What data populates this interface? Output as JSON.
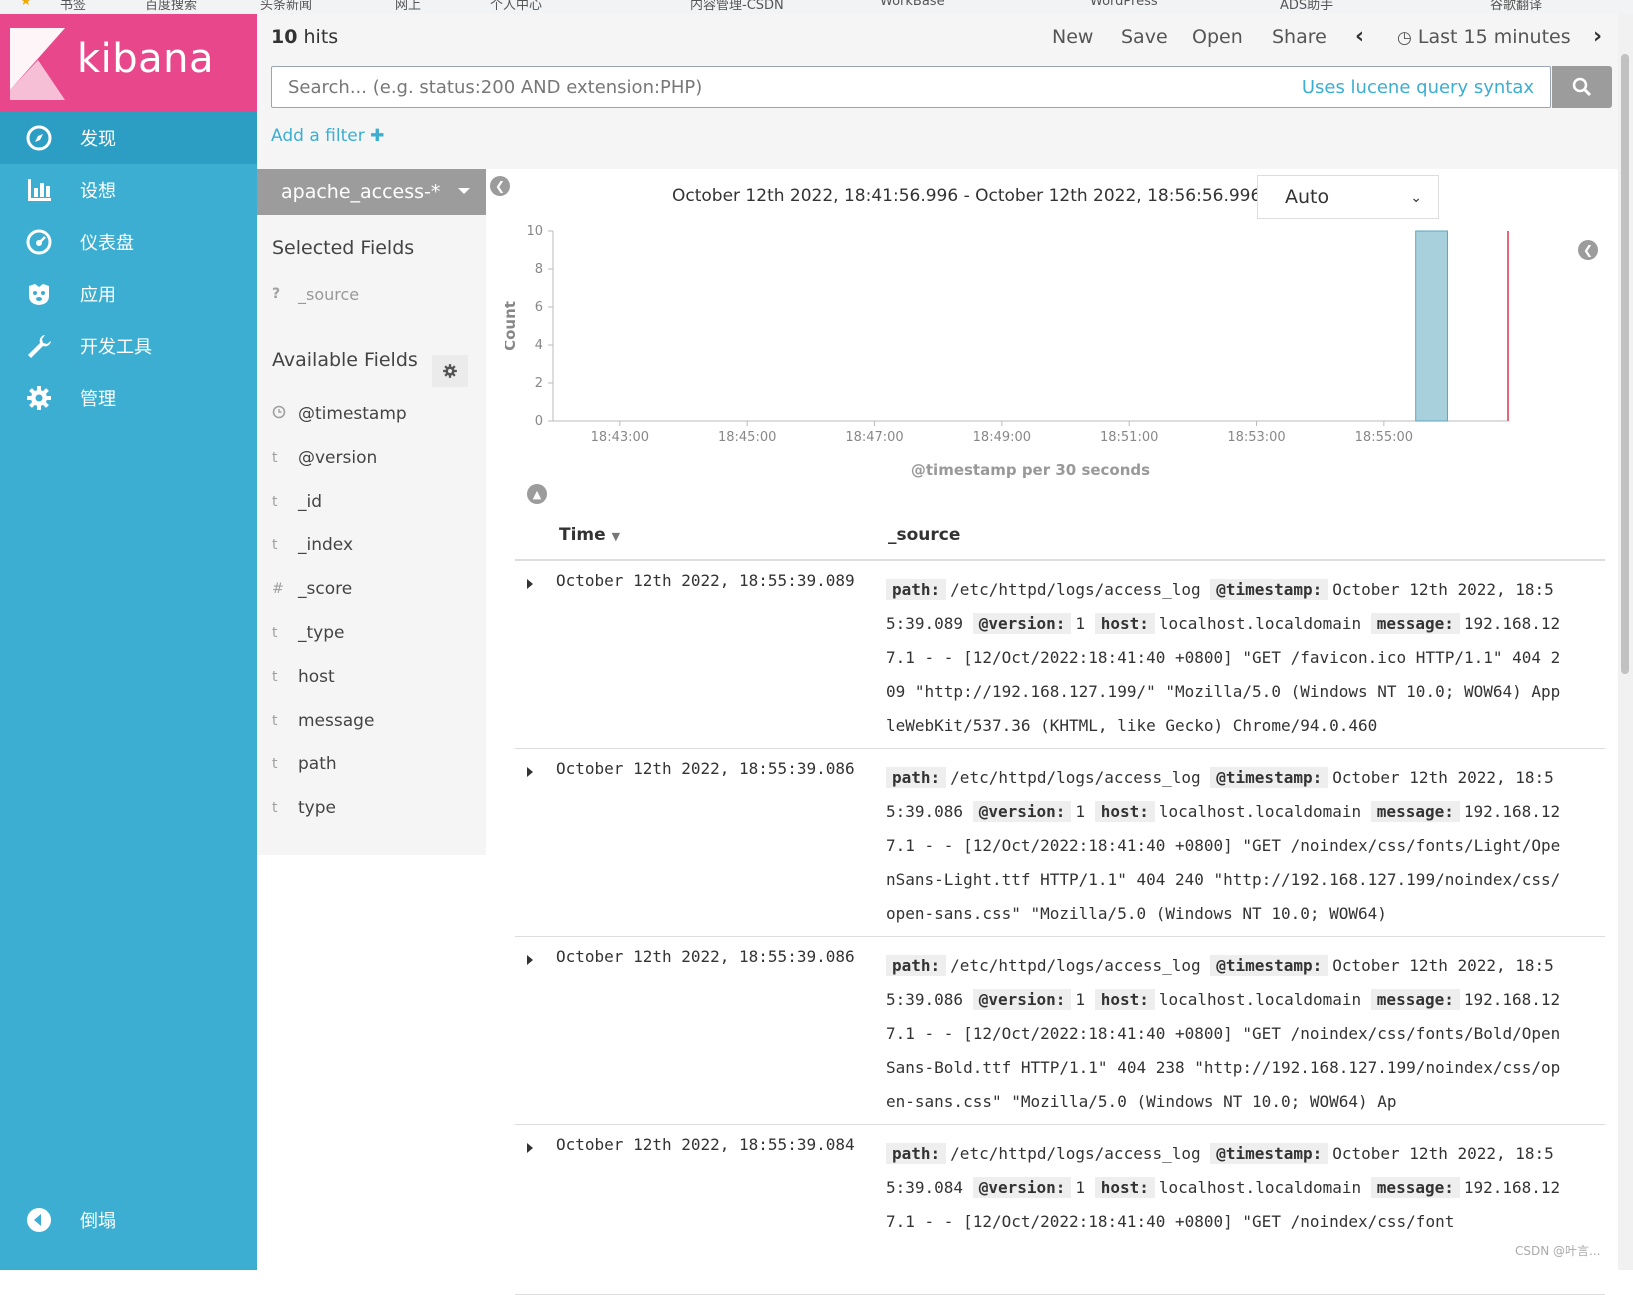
{
  "browser": {
    "bookmarks": [
      "书签",
      "百度搜索",
      "头条新闻",
      "网上",
      "个人中心",
      "内容管理-CSDN",
      "WorkBase",
      "WordPress",
      "ADS助手",
      "谷歌翻译"
    ]
  },
  "app": {
    "logo_text": "kibana"
  },
  "nav": [
    {
      "label": "发现",
      "icon": "compass-icon",
      "active": true
    },
    {
      "label": "设想",
      "icon": "bar-chart-icon",
      "active": false
    },
    {
      "label": "仪表盘",
      "icon": "dashboard-icon",
      "active": false
    },
    {
      "label": "应用",
      "icon": "bear-icon",
      "active": false
    },
    {
      "label": "开发工具",
      "icon": "wrench-icon",
      "active": false
    },
    {
      "label": "管理",
      "icon": "gear-icon",
      "active": false
    },
    {
      "label": "倒塌",
      "icon": "collapse-icon",
      "active": false
    }
  ],
  "topbar": {
    "hits_count": "10",
    "hits_label": " hits",
    "menu": {
      "new": "New",
      "save": "Save",
      "open": "Open",
      "share": "Share"
    },
    "time_picker": "Last 15 minutes"
  },
  "search": {
    "placeholder": "Search... (e.g. status:200 AND extension:PHP)",
    "syntax_link": "Uses lucene query syntax"
  },
  "filter": {
    "add_label": "Add a filter"
  },
  "fields_panel": {
    "index_pattern": "apache_access-*",
    "selected_title": "Selected Fields",
    "selected": [
      {
        "type": "?",
        "name": "_source"
      }
    ],
    "available_title": "Available Fields",
    "available": [
      {
        "type": "clock",
        "name": "@timestamp"
      },
      {
        "type": "t",
        "name": "@version"
      },
      {
        "type": "t",
        "name": "_id"
      },
      {
        "type": "t",
        "name": "_index"
      },
      {
        "type": "#",
        "name": "_score"
      },
      {
        "type": "t",
        "name": "_type"
      },
      {
        "type": "t",
        "name": "host"
      },
      {
        "type": "t",
        "name": "message"
      },
      {
        "type": "t",
        "name": "path"
      },
      {
        "type": "t",
        "name": "type"
      }
    ]
  },
  "histogram": {
    "range_text": "October 12th 2022, 18:41:56.996 - October 12th 2022, 18:56:56.996 —",
    "interval": "Auto"
  },
  "chart_data": {
    "type": "bar",
    "ylabel": "Count",
    "xlabel": "@timestamp per 30 seconds",
    "ylim": [
      0,
      10
    ],
    "yticks": [
      0,
      2,
      4,
      6,
      8,
      10
    ],
    "xticks": [
      "18:43:00",
      "18:45:00",
      "18:47:00",
      "18:49:00",
      "18:51:00",
      "18:53:00",
      "18:55:00"
    ],
    "x_range": [
      "18:41:56.996",
      "18:56:56.996"
    ],
    "bars": [
      {
        "x": "18:55:30",
        "value": 10
      }
    ],
    "now_marker": "18:56:56.996",
    "colors": {
      "bar": "#a8cfdc",
      "bar_stroke": "#5aa7c2",
      "now": "#e7667a"
    }
  },
  "table": {
    "columns": {
      "time": "Time",
      "source": "_source"
    },
    "rows": [
      {
        "time": "October 12th 2022, 18:55:39.089",
        "path": "/etc/httpd/logs/access_log",
        "timestamp": "October 12th 2022, 18:55:39.089",
        "version": "1",
        "host": "localhost.localdomain",
        "message": "192.168.127.1 - - [12/Oct/2022:18:41:40 +0800] \"GET /favicon.ico HTTP/1.1\" 404 209 \"http://192.168.127.199/\" \"Mozilla/5.0 (Windows NT 10.0; WOW64) AppleWebKit/537.36 (KHTML, like Gecko) Chrome/94.0.460"
      },
      {
        "time": "October 12th 2022, 18:55:39.086",
        "path": "/etc/httpd/logs/access_log",
        "timestamp": "October 12th 2022, 18:55:39.086",
        "version": "1",
        "host": "localhost.localdomain",
        "message": "192.168.127.1 - - [12/Oct/2022:18:41:40 +0800] \"GET /noindex/css/fonts/Light/OpenSans-Light.ttf HTTP/1.1\" 404 240 \"http://192.168.127.199/noindex/css/open-sans.css\" \"Mozilla/5.0 (Windows NT 10.0; WOW64)"
      },
      {
        "time": "October 12th 2022, 18:55:39.086",
        "path": "/etc/httpd/logs/access_log",
        "timestamp": "October 12th 2022, 18:55:39.086",
        "version": "1",
        "host": "localhost.localdomain",
        "message": "192.168.127.1 - - [12/Oct/2022:18:41:40 +0800] \"GET /noindex/css/fonts/Bold/OpenSans-Bold.ttf HTTP/1.1\" 404 238 \"http://192.168.127.199/noindex/css/open-sans.css\" \"Mozilla/5.0 (Windows NT 10.0; WOW64) Ap"
      },
      {
        "time": "October 12th 2022, 18:55:39.084",
        "path": "/etc/httpd/logs/access_log",
        "timestamp": "October 12th 2022, 18:55:39.084",
        "version": "1",
        "host": "localhost.localdomain",
        "message": "192.168.127.1 - - [12/Oct/2022:18:41:40 +0800] \"GET /noindex/css/font"
      }
    ],
    "source_keys": {
      "path": "path:",
      "timestamp": "@timestamp:",
      "version": "@version:",
      "host": "host:",
      "message": "message:"
    }
  },
  "watermark": "CSDN @叶言..."
}
